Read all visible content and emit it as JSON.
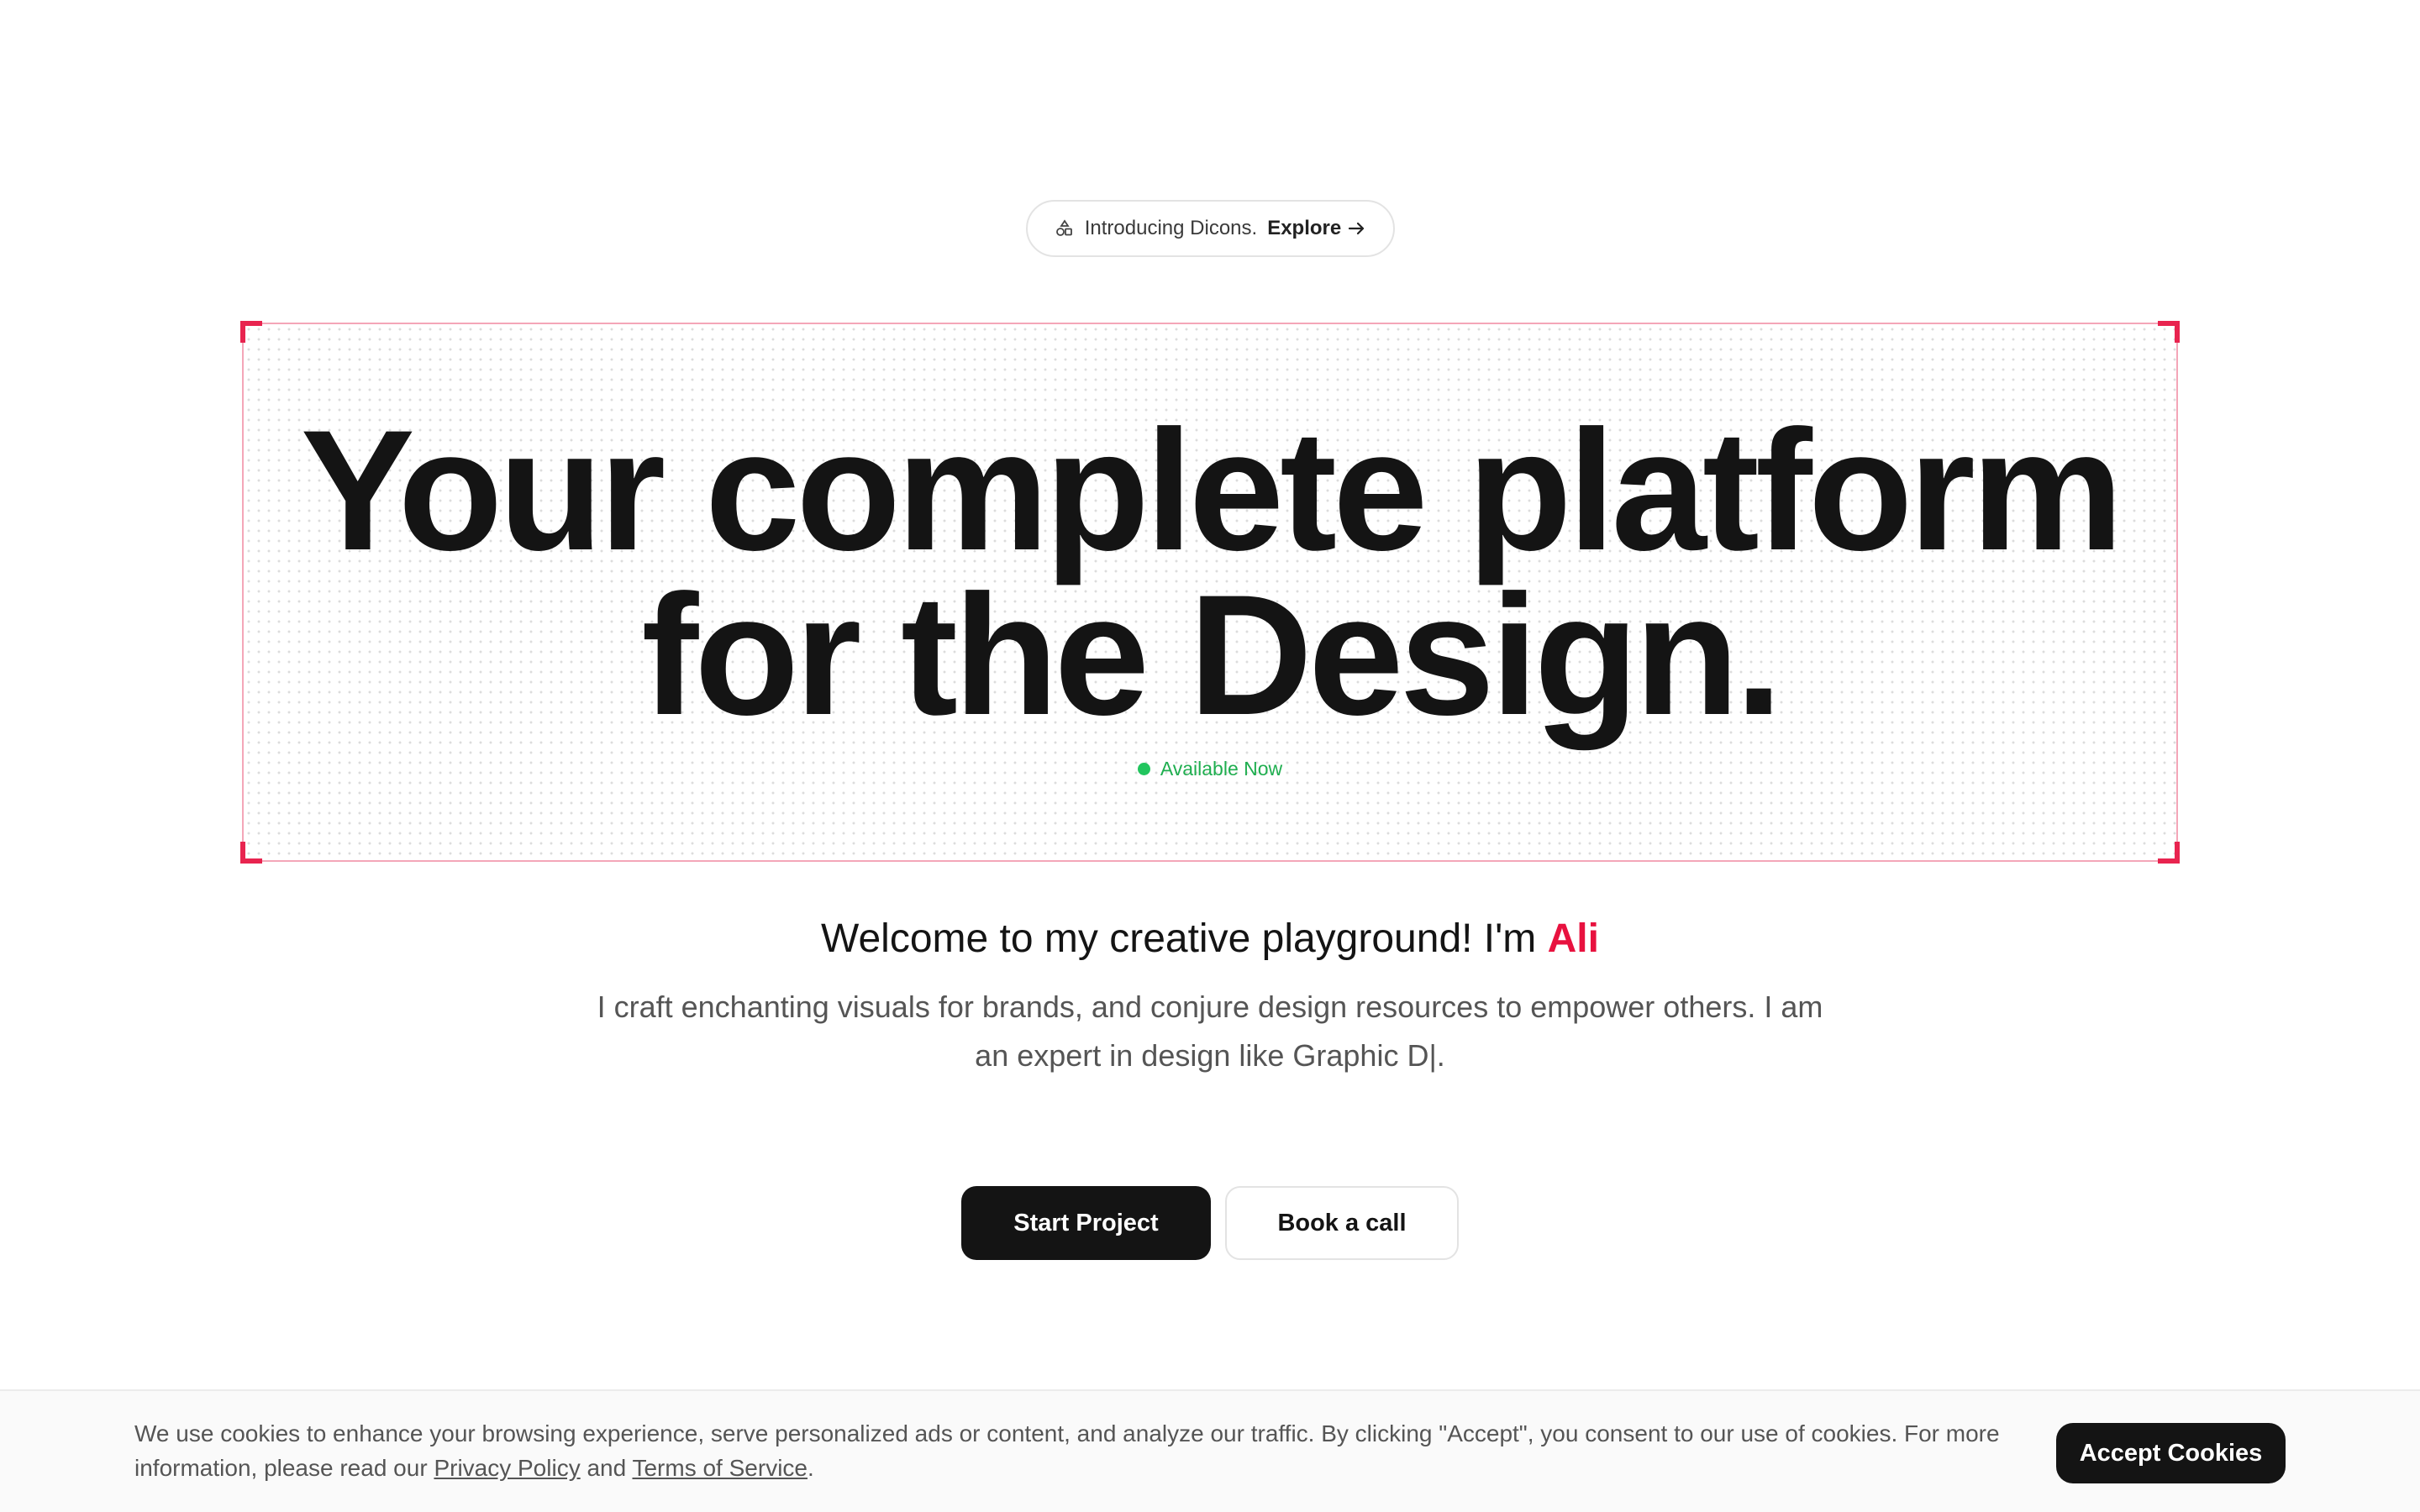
{
  "announcement": {
    "text": "Introducing Dicons.",
    "link_label": "Explore",
    "icon": "shapes-icon",
    "arrow_icon": "arrow-right-icon"
  },
  "hero": {
    "title_line1": "Your complete platform",
    "title_line2": "for the Design.",
    "status_text": "Available Now",
    "status_color": "#22c55e",
    "frame_accent": "#e8244f"
  },
  "intro": {
    "welcome_text": "Welcome to my creative playground! I'm ",
    "name": "Ali",
    "name_color": "#e8123f",
    "description": "I craft enchanting visuals for brands, and conjure design resources to empower others. I am an expert in design like Graphic D|."
  },
  "cta": {
    "primary_label": "Start Project",
    "secondary_label": "Book a call"
  },
  "cookie": {
    "text_before": "We use cookies to enhance your browsing experience, serve personalized ads or content, and analyze our traffic. By clicking \"Accept\", you consent to our use of cookies. For more information, please read our ",
    "privacy_label": "Privacy Policy",
    "and_text": " and ",
    "terms_label": "Terms of Service",
    "period": ".",
    "accept_label": "Accept Cookies"
  }
}
